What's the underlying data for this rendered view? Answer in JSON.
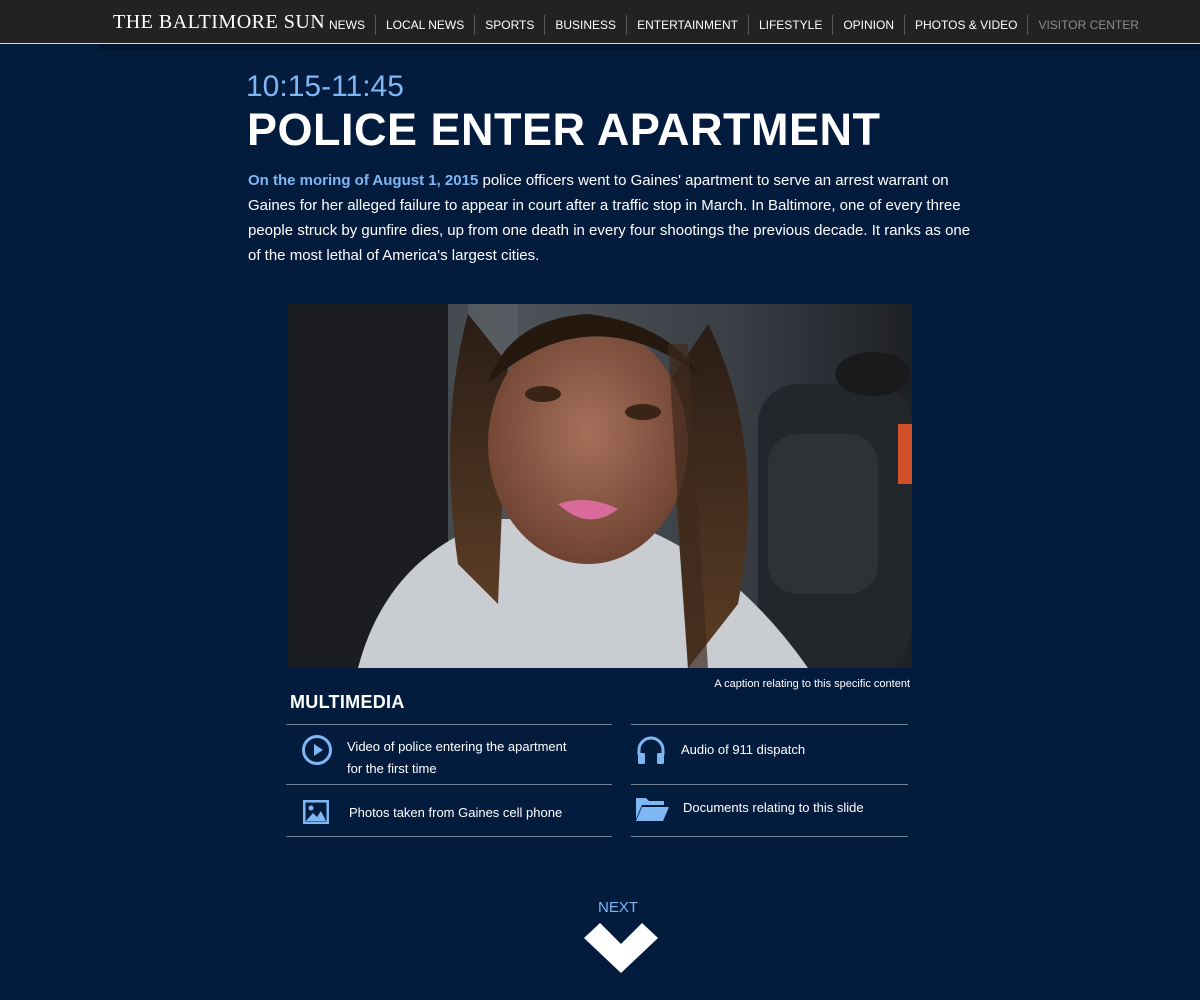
{
  "header": {
    "logo": "THE BALTIMORE SUN",
    "nav": [
      {
        "label": "NEWS"
      },
      {
        "label": "LOCAL NEWS"
      },
      {
        "label": "SPORTS"
      },
      {
        "label": "BUSINESS"
      },
      {
        "label": "ENTERTAINMENT"
      },
      {
        "label": "LIFESTYLE"
      },
      {
        "label": "OPINION"
      },
      {
        "label": "PHOTOS & VIDEO"
      },
      {
        "label": "VISITOR CENTER"
      }
    ]
  },
  "slide": {
    "time": "10:15-11:45",
    "headline": "POLICE ENTER APARTMENT",
    "lead": "On the moring of August 1, 2015",
    "body": " police officers went to Gaines' apartment to serve an arrest warrant on Gaines for her alleged failure to appear in court after a traffic stop in March. In Baltimore, one of every three people struck by gunfire dies, up from one death in every four shootings the previous decade. It ranks as one of the most lethal of America's largest cities.",
    "caption": "A caption relating to this specific content"
  },
  "multimedia": {
    "title": "MULTIMEDIA",
    "items": [
      {
        "label_line1": "Video of police entering the apartment",
        "label_line2": "for the first time",
        "icon": "play-circle-icon"
      },
      {
        "label": "Audio of 911 dispatch",
        "icon": "headphones-icon"
      },
      {
        "label": "Photos taken from Gaines cell phone",
        "icon": "image-icon"
      },
      {
        "label": "Documents relating to this slide",
        "icon": "folder-open-icon"
      }
    ]
  },
  "next": {
    "label": "NEXT",
    "icon": "chevron-down-icon"
  },
  "colors": {
    "background": "#031c3e",
    "accent": "#7fb6f4",
    "topbar": "#222222"
  }
}
